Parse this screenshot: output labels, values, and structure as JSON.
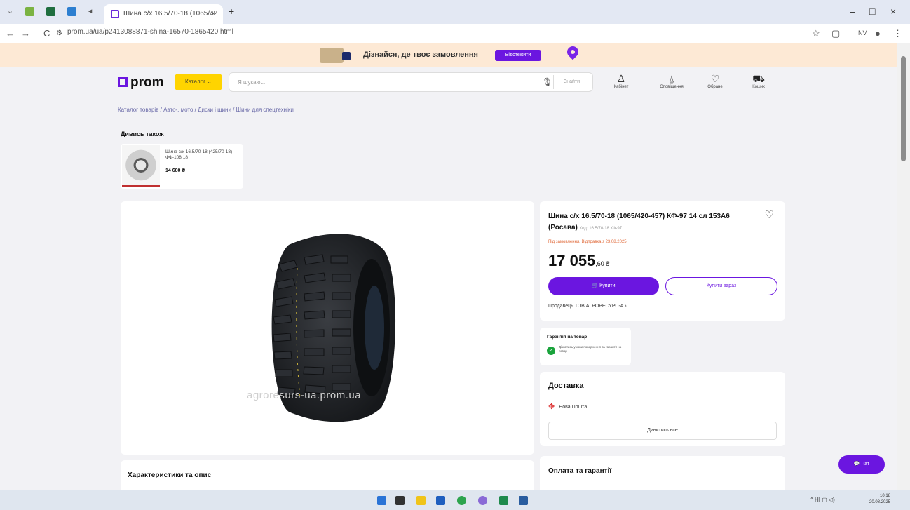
{
  "browser": {
    "tab_title": "Шина с/х 16.5/70-18 (1065/42",
    "tab_close": "×",
    "new_tab": "+",
    "url": "prom.ua/ua/p2413088871-shina-16570-1865420.html",
    "nav": {
      "back": "←",
      "forward": "→",
      "reload": "C"
    },
    "window": {
      "minimize": "–",
      "maximize": "□",
      "close": "×"
    }
  },
  "banner": {
    "text": "Дізнайся, де твоє замовлення",
    "button": "Відстежити"
  },
  "header": {
    "logo": "prom",
    "catalog_button": "Каталог ⌄",
    "search_placeholder": "Я шукаю...",
    "search_button": "Знайти",
    "icons": [
      {
        "glyph": "♙",
        "label": "Кабінет"
      },
      {
        "glyph": "⍙",
        "label": "Сповіщення"
      },
      {
        "glyph": "♡",
        "label": "Обране"
      },
      {
        "glyph": "⛟",
        "label": "Кошик"
      }
    ]
  },
  "breadcrumbs": "Каталог товарів  /  Авто-, мото  /  Диски і шини  /  Шини для спецтехніки",
  "see_also": {
    "title": "Дивись також",
    "item_name": "Шина с/х 16.5/70-18 (425/70-18) ФФ-108 18",
    "item_price": "14 680 ₴"
  },
  "gallery": {
    "watermark": "agroresurs-ua.prom.ua"
  },
  "product": {
    "title": "Шина с/х 16.5/70-18 (1065/420-457) КФ-97 14 сл 153А6 (Росава)",
    "code": "Код: 16.5/70-18 КФ-97",
    "availability": "Під замовлення. Відправка з 23.08.2025",
    "price_main": "17 055",
    "price_cents": ",60 ₴",
    "buy_button": "🛒 Купити",
    "buy_now_button": "Купити зараз",
    "seller": "Продавець ТОВ АГРОРЕСУРС-А  ›"
  },
  "guarantee": {
    "title": "Гарантія на товар",
    "text": "Дізнатись умови повернення та гарантії на товар"
  },
  "delivery": {
    "title": "Доставка",
    "nova_poshta": "Нова Пошта",
    "all_button": "Дивитись все"
  },
  "payment": {
    "title": "Оплата та гарантії"
  },
  "specs": {
    "title": "Характеристики та опис"
  },
  "chat": {
    "label": "💬 Чат"
  },
  "taskbar": {
    "tray_text": "^  НІ  ▢  ◁)",
    "time": "10:18",
    "date": "20.08.2025"
  },
  "colors": {
    "accent": "#6b16e0",
    "yellow": "#ffd400",
    "banner_bg": "#fde9d5"
  }
}
